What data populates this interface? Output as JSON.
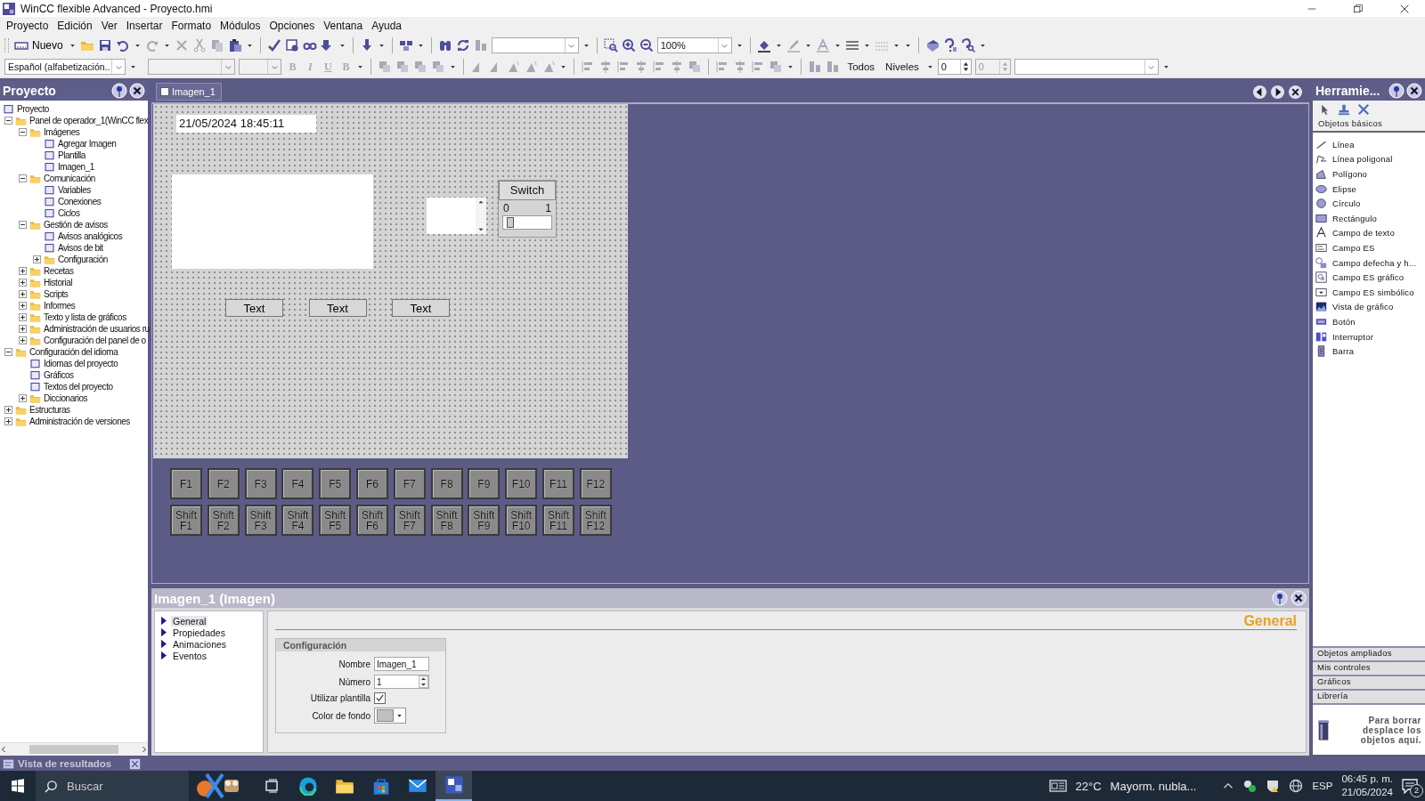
{
  "window": {
    "title": "WinCC flexible Advanced - Proyecto.hmi"
  },
  "menu": [
    "Proyecto",
    "Edición",
    "Ver",
    "Insertar",
    "Formato",
    "Módulos",
    "Opciones",
    "Ventana",
    "Ayuda"
  ],
  "toolbar": {
    "new_label": "Nuevo",
    "zoom": "100%",
    "language": "Español (alfabetización..",
    "format_buttons": [
      "B",
      "I",
      "U",
      "B"
    ],
    "all_label": "Todos",
    "levels_label": "Niveles",
    "level_value": "0",
    "level_value_2": "0"
  },
  "project_panel": {
    "title": "Proyecto",
    "tree": [
      {
        "label": "Proyecto",
        "children": [
          {
            "label": "Panel de operador_1(WinCC flex",
            "expanded": true,
            "children": [
              {
                "label": "Imágenes",
                "expanded": true,
                "children": [
                  {
                    "label": "Agregar Imagen"
                  },
                  {
                    "label": "Plantilla"
                  },
                  {
                    "label": "Imagen_1"
                  }
                ]
              },
              {
                "label": "Comunicación",
                "expanded": true,
                "children": [
                  {
                    "label": "Variables"
                  },
                  {
                    "label": "Conexiones"
                  },
                  {
                    "label": "Ciclos"
                  }
                ]
              },
              {
                "label": "Gestión de avisos",
                "expanded": true,
                "children": [
                  {
                    "label": "Avisos analógicos"
                  },
                  {
                    "label": "Avisos de bit"
                  },
                  {
                    "label": "Configuración",
                    "expanded": false
                  }
                ]
              },
              {
                "label": "Recetas",
                "expanded": false
              },
              {
                "label": "Historial",
                "expanded": false
              },
              {
                "label": "Scripts",
                "expanded": false
              },
              {
                "label": "Informes",
                "expanded": false
              },
              {
                "label": "Texto y lista de gráficos",
                "expanded": false
              },
              {
                "label": "Administración de usuarios ru",
                "expanded": false
              },
              {
                "label": "Configuración del panel de o",
                "expanded": false
              }
            ]
          },
          {
            "label": "Configuración del idioma",
            "expanded": true,
            "children": [
              {
                "label": "Idiomas del proyecto"
              },
              {
                "label": "Gráficos"
              },
              {
                "label": "Textos del proyecto"
              },
              {
                "label": "Diccionarios",
                "expanded": false
              }
            ]
          },
          {
            "label": "Estructuras",
            "expanded": false
          },
          {
            "label": "Administración de versiones",
            "expanded": false
          }
        ]
      }
    ]
  },
  "editor": {
    "tab": "Imagen_1",
    "datetime": "21/05/2024 18:45:11",
    "switch": {
      "label": "Switch",
      "off": "0",
      "on": "1",
      "state_on": false
    },
    "buttons": [
      "Text",
      "Text",
      "Text"
    ],
    "function_keys": [
      "F1",
      "F2",
      "F3",
      "F4",
      "F5",
      "F6",
      "F7",
      "F8",
      "F9",
      "F10",
      "F11",
      "F12"
    ],
    "shift_keys": [
      "Shift F1",
      "Shift F2",
      "Shift F3",
      "Shift F4",
      "Shift F5",
      "Shift F6",
      "Shift F7",
      "Shift F8",
      "Shift F9",
      "Shift F10",
      "Shift F11",
      "Shift F12"
    ]
  },
  "properties": {
    "title": "Imagen_1 (Imagen)",
    "heading": "General",
    "group": "Configuración",
    "nav": [
      {
        "label": "General",
        "selected": true
      },
      {
        "label": "Propiedades",
        "selected": false
      },
      {
        "label": "Animaciones",
        "selected": false
      },
      {
        "label": "Eventos",
        "selected": false
      }
    ],
    "fields": [
      {
        "kind": "text",
        "label": "Nombre",
        "value": "Imagen_1"
      },
      {
        "kind": "spin",
        "label": "Número",
        "value": "1"
      },
      {
        "kind": "checkbox",
        "label": "Utilizar plantilla",
        "checked": true
      },
      {
        "kind": "color",
        "label": "Color de fondo",
        "color": "#c0c0c0"
      }
    ]
  },
  "toolbox": {
    "title": "Herramie...",
    "section": {
      "label": "Objetos básicos",
      "selected": true
    },
    "items": [
      "Línea",
      "Línea poligonal",
      "Polígono",
      "Elipse",
      "Círculo",
      "Rectángulo",
      "Campo de texto",
      "Campo ES",
      "Campo defecha y h...",
      "Campo ES gráfico",
      "Campo ES simbólico",
      "Vista de gráfico",
      "Botón",
      "Interruptor",
      "Barra"
    ],
    "categories": [
      {
        "label": "Objetos ampliados",
        "selected": false
      },
      {
        "label": "Mis controles",
        "selected": false
      },
      {
        "label": "Gráficos",
        "selected": false
      },
      {
        "label": "Librería",
        "selected": false
      }
    ],
    "trash_text": "Para borrar desplace los objetos aquí."
  },
  "output_bar": {
    "title": "Vista de resultados"
  },
  "taskbar": {
    "search": "Buscar",
    "temperature": "22°C",
    "weather": "Mayorm. nubla...",
    "language": "ESP",
    "time": "06:45 p. m.",
    "date": "21/05/2024",
    "notifications": "2"
  }
}
